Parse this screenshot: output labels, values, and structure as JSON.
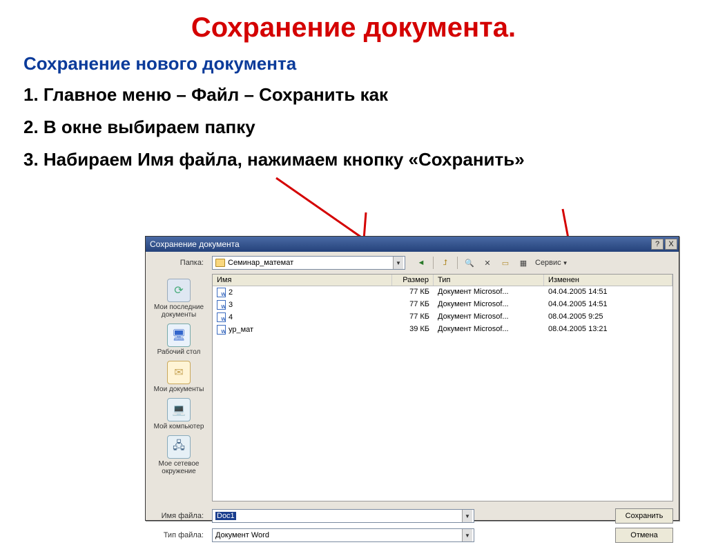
{
  "slide": {
    "title": "Сохранение документа.",
    "subtitle": "Сохранение нового документа",
    "step1": "1. Главное меню – Файл – Сохранить как",
    "step2": "2. В окне выбираем папку",
    "step3": "3. Набираем Имя файла, нажимаем кнопку «Сохранить»"
  },
  "dialog": {
    "title": "Сохранение документа",
    "help_glyph": "?",
    "close_glyph": "X",
    "folder_label": "Папка:",
    "folder_value": "Семинар_математ",
    "tools_label": "Сервис",
    "columns": {
      "name": "Имя",
      "size": "Размер",
      "type": "Тип",
      "modified": "Изменен"
    },
    "places": [
      {
        "label": "Мои последние документы"
      },
      {
        "label": "Рабочий стол"
      },
      {
        "label": "Мои документы"
      },
      {
        "label": "Мой компьютер"
      },
      {
        "label": "Мое сетевое окружение"
      }
    ],
    "files": [
      {
        "name": "2",
        "size": "77 КБ",
        "type": "Документ Microsof...",
        "modified": "04.04.2005 14:51"
      },
      {
        "name": "3",
        "size": "77 КБ",
        "type": "Документ Microsof...",
        "modified": "04.04.2005 14:51"
      },
      {
        "name": "4",
        "size": "77 КБ",
        "type": "Документ Microsof...",
        "modified": "08.04.2005 9:25"
      },
      {
        "name": "ур_мат",
        "size": "39 КБ",
        "type": "Документ Microsof...",
        "modified": "08.04.2005 13:21"
      }
    ],
    "filename_label": "Имя файла:",
    "filename_value": "Doc1",
    "filetype_label": "Тип файла:",
    "filetype_value": "Документ Word",
    "save_button": "Сохранить",
    "cancel_button": "Отмена"
  }
}
